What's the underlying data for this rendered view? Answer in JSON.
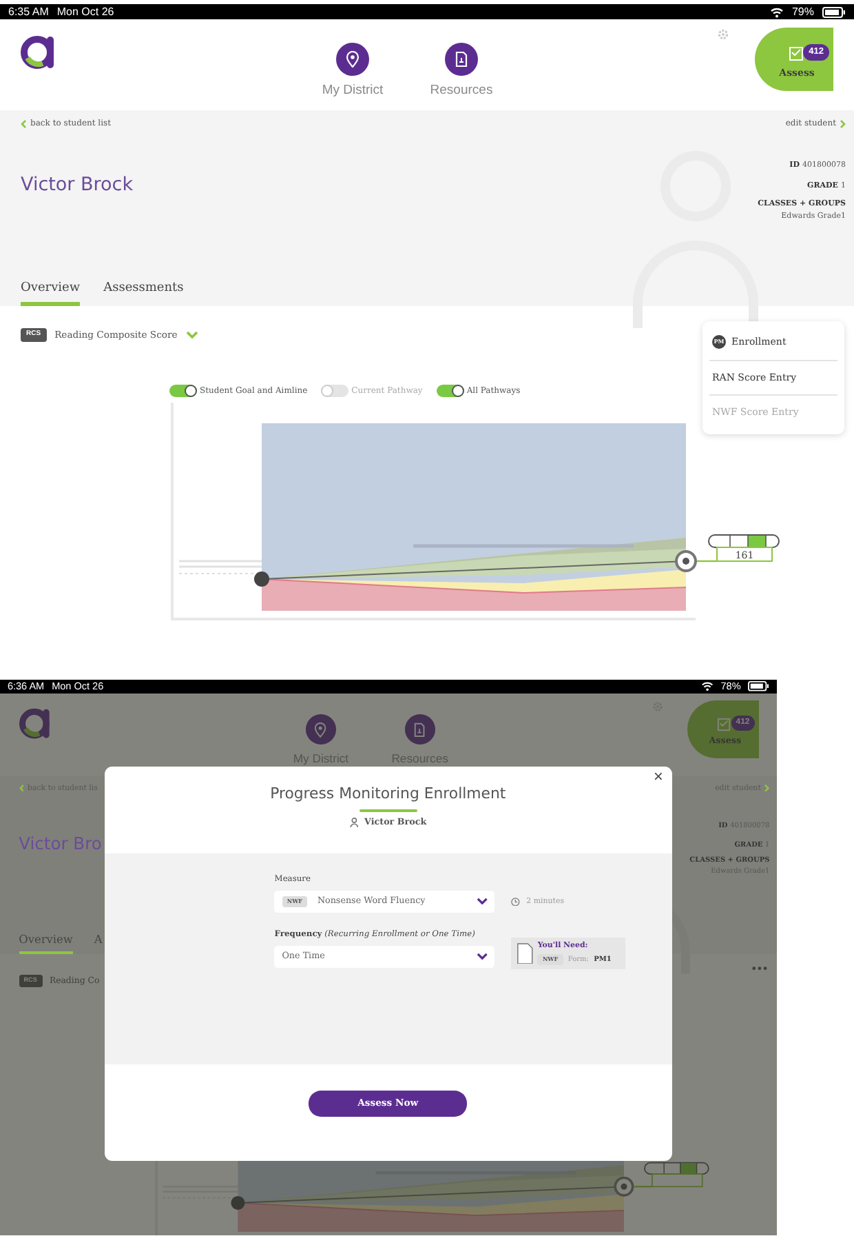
{
  "screen_1": {
    "status_bar": {
      "time": "6:35 AM",
      "date": "Mon Oct 26",
      "battery": "79%"
    },
    "nav": [
      {
        "label": "My District",
        "kind": "district"
      },
      {
        "label": "Resources",
        "kind": "resources"
      }
    ],
    "assess": {
      "label": "Assess",
      "count": "412"
    },
    "back_link": "back to student list",
    "edit_link": "edit student",
    "student": {
      "name": "Victor Brock",
      "id_label": "ID",
      "id": "401800078",
      "grade_label": "GRADE",
      "grade": "1",
      "classes_label": "CLASSES + GROUPS",
      "classes": "Edwards Grade1"
    },
    "tabs": [
      {
        "label": "Overview",
        "selected": true
      },
      {
        "label": "Assessments",
        "selected": false
      }
    ],
    "measure": {
      "badge": "RCS",
      "label": "Reading Composite Score"
    },
    "toggles": [
      {
        "label": "Student Goal and Aimline",
        "on": true
      },
      {
        "label": "Current Pathway",
        "on": false
      },
      {
        "label": "All Pathways",
        "on": true
      }
    ],
    "menu_open": true,
    "menu": [
      {
        "label": "Enrollment",
        "badge": "PM",
        "disabled": false
      },
      {
        "label": "RAN Score Entry",
        "disabled": false
      },
      {
        "label": "NWF Score Entry",
        "disabled": true
      }
    ],
    "score": "161"
  },
  "screen_2": {
    "status_bar": {
      "time": "6:36 AM",
      "date": "Mon Oct 26",
      "battery": "78%"
    },
    "nav": [
      {
        "label": "My District",
        "kind": "district"
      },
      {
        "label": "Resources",
        "kind": "resources"
      }
    ],
    "assess": {
      "label": "Assess",
      "count": "412"
    },
    "back_link": "back to student lis",
    "edit_link": "edit student",
    "student": {
      "name": "Victor Bro",
      "id_label": "ID",
      "id": "401800078",
      "grade_label": "GRADE",
      "grade": "1",
      "classes_label": "CLASSES + GROUPS",
      "classes": "Edwards Grade1"
    },
    "tabs": [
      {
        "label": "Overview",
        "selected": true
      },
      {
        "label": "A",
        "selected": false
      }
    ],
    "measure": {
      "badge": "RCS",
      "label": "Reading Co"
    },
    "menu_open": false,
    "modal": {
      "title": "Progress Monitoring Enrollment",
      "student": "Victor Brock",
      "close": "×",
      "measure": {
        "label": "Measure",
        "badge": "NWF",
        "value": "Nonsense Word Fluency",
        "duration": "2 minutes"
      },
      "frequency": {
        "label": "**Frequency** *(Recurring Enrollment or One Time)*",
        "value": "One Time"
      },
      "materials": {
        "title": "You'll Need:",
        "badge": "NWF",
        "form_label": "Form:",
        "form": "PM1"
      },
      "button": "Assess Now"
    }
  }
}
